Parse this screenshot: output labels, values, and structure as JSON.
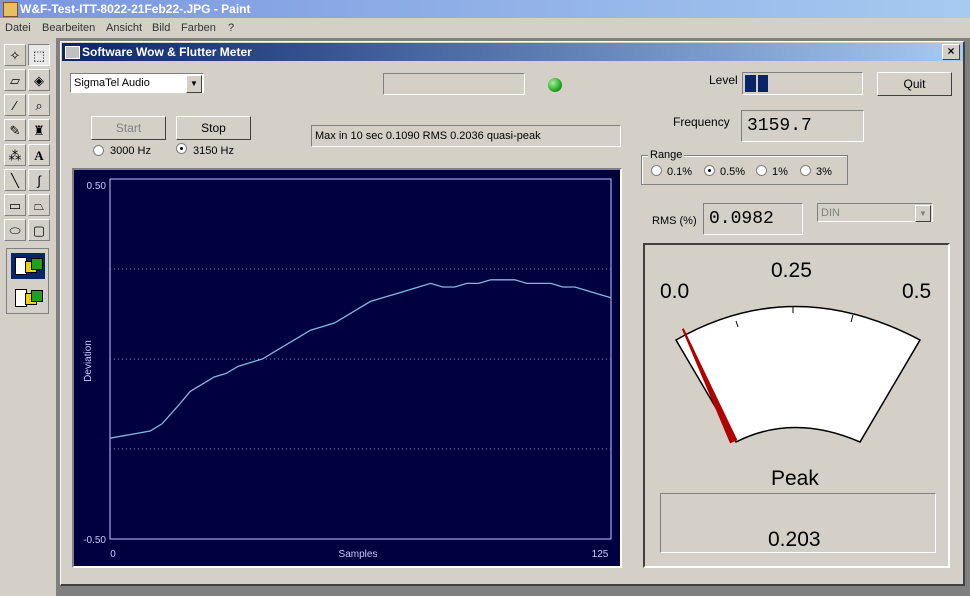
{
  "paint": {
    "title": "W&F-Test-ITT-8022-21Feb22-.JPG - Paint",
    "menu": [
      "Datei",
      "Bearbeiten",
      "Ansicht",
      "Bild",
      "Farben",
      "?"
    ],
    "tools": [
      "free-select-icon",
      "rect-select-icon",
      "eraser-icon",
      "fill-icon",
      "picker-icon",
      "magnifier-icon",
      "pencil-icon",
      "brush-icon",
      "airbrush-icon",
      "text-icon",
      "line-icon",
      "curve-icon",
      "rectangle-icon",
      "polygon-icon",
      "ellipse-icon",
      "rounded-rect-icon"
    ]
  },
  "meter": {
    "title": "Software Wow & Flutter Meter",
    "close": "×",
    "device": "SigmaTel Audio",
    "level_label": "Level",
    "level_fraction": 0.2,
    "quit": "Quit",
    "start": "Start",
    "stop": "Stop",
    "freq_options": [
      "3000 Hz",
      "3150 Hz"
    ],
    "freq_selected": "3150 Hz",
    "status": "Max in 10 sec 0.1090 RMS 0.2036 quasi-peak",
    "frequency_label": "Frequency",
    "frequency_value": "3159.7",
    "range_label": "Range",
    "range_options": [
      "0.1%",
      "0.5%",
      "1%",
      "3%"
    ],
    "range_selected": "0.5%",
    "rms_label": "RMS (%)",
    "rms_value": "0.0982",
    "weighting": "DIN",
    "gauge": {
      "min_label": "0.0",
      "mid_label": "0.25",
      "max_label": "0.5",
      "value": 0.0982,
      "max": 0.5,
      "needle_color": "#b00000"
    },
    "peak_label": "Peak",
    "peak_value": "0.203",
    "indicator_color": "#22aa22"
  },
  "chart_data": {
    "type": "line",
    "title": "",
    "xlabel": "Samples",
    "ylabel": "Deviation",
    "xlim": [
      0,
      125
    ],
    "ylim": [
      -0.5,
      0.5
    ],
    "xticks": [
      "0",
      "125"
    ],
    "yticks": [
      "0.50",
      "-0.50"
    ],
    "grid": "dotted horizontal",
    "series": [
      {
        "color": "#7fb8e8",
        "x": [
          0,
          5,
          10,
          13,
          17,
          20,
          23,
          26,
          29,
          32,
          35,
          38,
          41,
          44,
          47,
          50,
          53,
          56,
          59,
          62,
          65,
          68,
          71,
          74,
          77,
          80,
          83,
          86,
          89,
          92,
          95,
          98,
          101,
          104,
          107,
          110,
          113,
          116,
          119,
          122,
          125
        ],
        "y": [
          -0.22,
          -0.21,
          -0.2,
          -0.18,
          -0.13,
          -0.09,
          -0.07,
          -0.05,
          -0.04,
          -0.02,
          -0.01,
          0.0,
          0.02,
          0.04,
          0.06,
          0.08,
          0.09,
          0.1,
          0.12,
          0.14,
          0.16,
          0.17,
          0.18,
          0.19,
          0.2,
          0.21,
          0.2,
          0.2,
          0.21,
          0.21,
          0.22,
          0.22,
          0.22,
          0.21,
          0.21,
          0.21,
          0.2,
          0.2,
          0.19,
          0.18,
          0.17
        ]
      }
    ]
  }
}
